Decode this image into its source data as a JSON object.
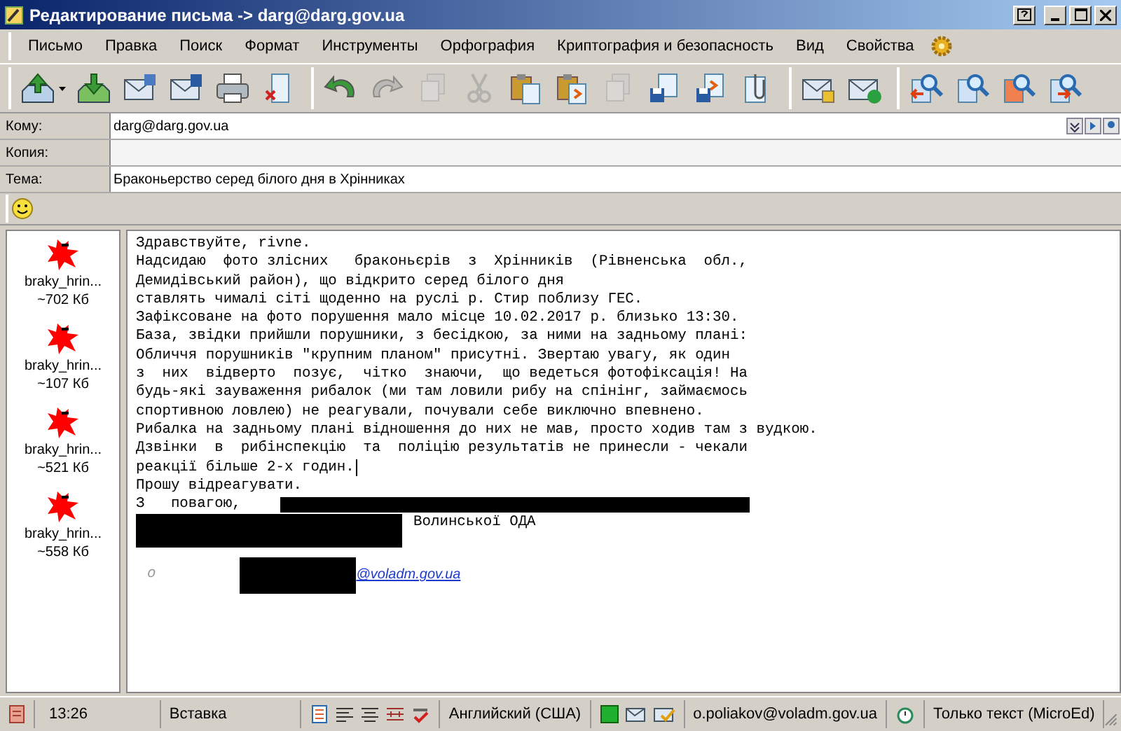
{
  "window": {
    "title": "Редактирование письма -> darg@darg.gov.ua"
  },
  "menu": [
    "Письмо",
    "Правка",
    "Поиск",
    "Формат",
    "Инструменты",
    "Орфография",
    "Криптография и безопасность",
    "Вид",
    "Свойства"
  ],
  "toolbar": [
    [
      {
        "kind": "send",
        "disabled": false
      },
      {
        "kind": "download",
        "disabled": false
      },
      {
        "kind": "mail-window",
        "disabled": false
      },
      {
        "kind": "mail-save",
        "disabled": false
      },
      {
        "kind": "printer",
        "disabled": false
      },
      {
        "kind": "delete-doc",
        "disabled": false
      }
    ],
    [
      {
        "kind": "undo",
        "disabled": false
      },
      {
        "kind": "redo",
        "disabled": true
      },
      {
        "kind": "copy",
        "disabled": true
      },
      {
        "kind": "cut",
        "disabled": true
      },
      {
        "kind": "paste",
        "disabled": false
      },
      {
        "kind": "paste-special",
        "disabled": false
      },
      {
        "kind": "save-small",
        "disabled": true
      },
      {
        "kind": "save-doc",
        "disabled": false
      },
      {
        "kind": "save-arrow",
        "disabled": false
      },
      {
        "kind": "attach",
        "disabled": false
      }
    ],
    [
      {
        "kind": "mail-lock",
        "disabled": false
      },
      {
        "kind": "mail-check",
        "disabled": false
      }
    ],
    [
      {
        "kind": "find-left",
        "disabled": false
      },
      {
        "kind": "find",
        "disabled": false
      },
      {
        "kind": "find-red",
        "disabled": false
      },
      {
        "kind": "find-right",
        "disabled": false
      }
    ]
  ],
  "fields": [
    {
      "label": "Кому:",
      "value": "darg@darg.gov.ua"
    },
    {
      "label": "Копия:"
    },
    {
      "label": "Тема:",
      "value": "Браконьерство серед білого дня в Хрінниках"
    }
  ],
  "attachments": [
    {
      "name": "braky_hrin...",
      "size": "~702 Кб"
    },
    {
      "name": "braky_hrin...",
      "size": "~107 Кб"
    },
    {
      "name": "braky_hrin...",
      "size": "~521 Кб"
    },
    {
      "name": "braky_hrin...",
      "size": "~558 Кб"
    }
  ],
  "body": [
    {
      "kind": "text",
      "text": "Здравствуйте, rivne."
    },
    {
      "kind": "text",
      "text": "Надсидаю  фото злісних   браконьєрів  з  Хрінників  (Рівненська  обл.,"
    },
    {
      "kind": "text",
      "text": "Демидівський район), що відкрито серед білого дня"
    },
    {
      "kind": "text",
      "text": "ставлять чималі сіті щоденно на руслі р. Стир поблизу ГЕС."
    },
    {
      "kind": "text",
      "text": "Зафіксоване на фото порушення мало місце 10.02.2017 р. близько 13:30."
    },
    {
      "kind": "text",
      "text": "База, звідки прийшли порушники, з бесідкою, за ними на задньому плані:"
    },
    {
      "kind": "text",
      "text": "Обличчя порушників \"крупним планом\" присутні. Звертаю увагу, як один"
    },
    {
      "kind": "text",
      "text": "з  них  відверто  позує,  чітко  знаючи,  що ведеться фотофіксація! На"
    },
    {
      "kind": "text",
      "text": "будь-які зауваження рибалок (ми там ловили рибу на спінінг, займаємось"
    },
    {
      "kind": "text",
      "text": "спортивною ловлею) не реагували, почували себе виключно впевнено."
    },
    {
      "kind": "text",
      "text": "Рибалка на задньому плані відношення до них не мав, просто ходив там з вудкою."
    },
    {
      "kind": "text",
      "text": "Дзвінки  в  рибінспекцію  та  поліцію результатів не принесли - чекали"
    },
    {
      "kind": "text",
      "text": "реакції більше 2-х годин."
    },
    {
      "kind": "text",
      "text": "Прошу відреагувати."
    },
    {
      "kind": "redacted-after",
      "text": "З   повагою,"
    },
    {
      "kind": "redacted-before",
      "text": "Волинської ОДА"
    },
    {
      "kind": "redacted-only"
    },
    {
      "kind": "blank"
    },
    {
      "kind": "link",
      "prefix": "о",
      "text": "@voladm.gov.ua"
    }
  ],
  "status_bar": {
    "time": "13:26",
    "mode": "Вставка",
    "language": "Английский (США)",
    "account": "o.poliakov@voladm.gov.ua",
    "format": "Только текст (MicroEd)"
  }
}
